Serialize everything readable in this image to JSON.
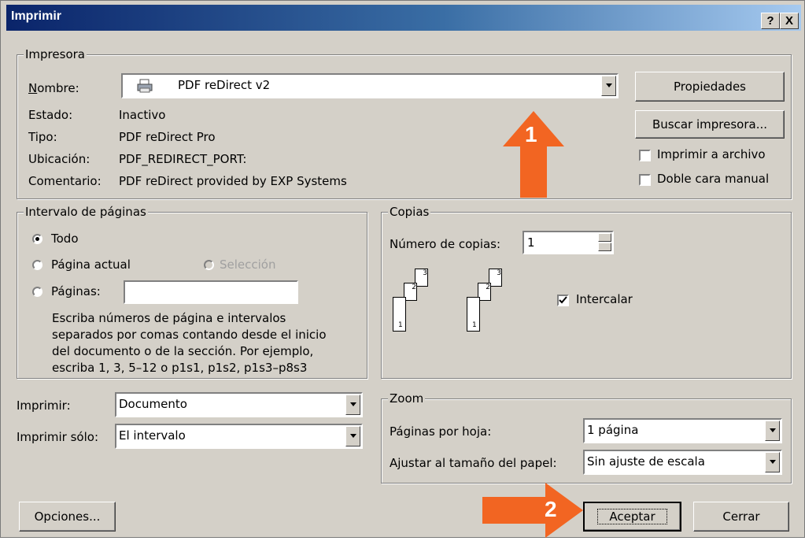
{
  "window": {
    "title": "Imprimir",
    "help_glyph": "?",
    "close_glyph": "X"
  },
  "printer": {
    "group_label": "Impresora",
    "name_label": "Nombre:",
    "name_value": "PDF reDirect v2",
    "status_label": "Estado:",
    "status_value": "Inactivo",
    "type_label": "Tipo:",
    "type_value": "PDF reDirect Pro",
    "location_label": "Ubicación:",
    "location_value": "PDF_REDIRECT_PORT:",
    "comment_label": "Comentario:",
    "comment_value": "PDF reDirect provided by EXP Systems",
    "properties_button": "Propiedades",
    "find_printer_button": "Buscar impresora...",
    "print_to_file_label": "Imprimir a archivo",
    "print_to_file_checked": false,
    "manual_duplex_label": "Doble cara manual",
    "manual_duplex_checked": false
  },
  "page_range": {
    "group_label": "Intervalo de páginas",
    "all_label": "Todo",
    "current_label": "Página actual",
    "selection_label": "Selección",
    "pages_label": "Páginas:",
    "pages_value": "",
    "selected": "all",
    "hint_lines": [
      "Escriba números de página e intervalos",
      "separados por comas contando desde el inicio",
      "del documento o de la sección. Por ejemplo,",
      "escriba 1, 3, 5–12 o p1s1, p1s2, p1s3–p8s3"
    ]
  },
  "copies": {
    "group_label": "Copias",
    "count_label": "Número de copias:",
    "count_value": "1",
    "collate_label": "Intercalar",
    "collate_checked": true,
    "page_numbers": [
      "1",
      "2",
      "3"
    ]
  },
  "print_what": {
    "label": "Imprimir:",
    "value": "Documento",
    "only_label": "Imprimir sólo:",
    "only_value": "El intervalo"
  },
  "zoom": {
    "group_label": "Zoom",
    "pages_per_sheet_label": "Páginas por hoja:",
    "pages_per_sheet_value": "1 página",
    "scale_label": "Ajustar al tamaño del papel:",
    "scale_value": "Sin ajuste de escala"
  },
  "footer": {
    "options_button": "Opciones...",
    "ok_button": "Aceptar",
    "cancel_button": "Cerrar"
  },
  "annotations": {
    "arrow1_label": "1",
    "arrow2_label": "2",
    "arrow_color": "#f26522"
  }
}
